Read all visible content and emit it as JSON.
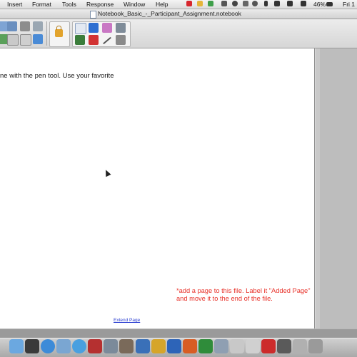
{
  "menubar": {
    "items": [
      "Insert",
      "Format",
      "Tools",
      "Response",
      "Window",
      "Help"
    ],
    "battery": "46%",
    "clock": "Fri 1"
  },
  "window": {
    "title": "Notebook_Basic_-_Participant_Assignment.notebook"
  },
  "page": {
    "instruction": "ne with the pen tool. Use your favorite",
    "note": "*add a page to this file. Label it \"Added Page\" and move it to the end of the file.",
    "extend_link": "Extend Page"
  },
  "colors": {
    "note_text": "#e8322a",
    "link_text": "#2b3fd1",
    "page_background": "#ffffff",
    "lock_icon": "#e2a32c"
  },
  "icons": {
    "toolbar_left": [
      "page-view-icon",
      "insert-picture-icon",
      "undo-icon",
      "attachment-icon",
      "screen-capture-icon",
      "display-icon",
      "table-icon",
      "delete-icon"
    ],
    "lock": "lock-icon",
    "drawing_tools": [
      "select-icon",
      "pen-icon",
      "eraser-icon",
      "magic-pen-icon",
      "fill-icon",
      "text-icon",
      "line-icon",
      "shape-pen-icon"
    ],
    "dock": [
      "finder-icon",
      "dashboard-icon",
      "safari-icon",
      "mail-icon",
      "itunes-icon",
      "calendar-icon",
      "photo-icon",
      "word-icon",
      "excel-icon",
      "powerpoint-icon",
      "notebook-icon",
      "trash-icon"
    ]
  }
}
